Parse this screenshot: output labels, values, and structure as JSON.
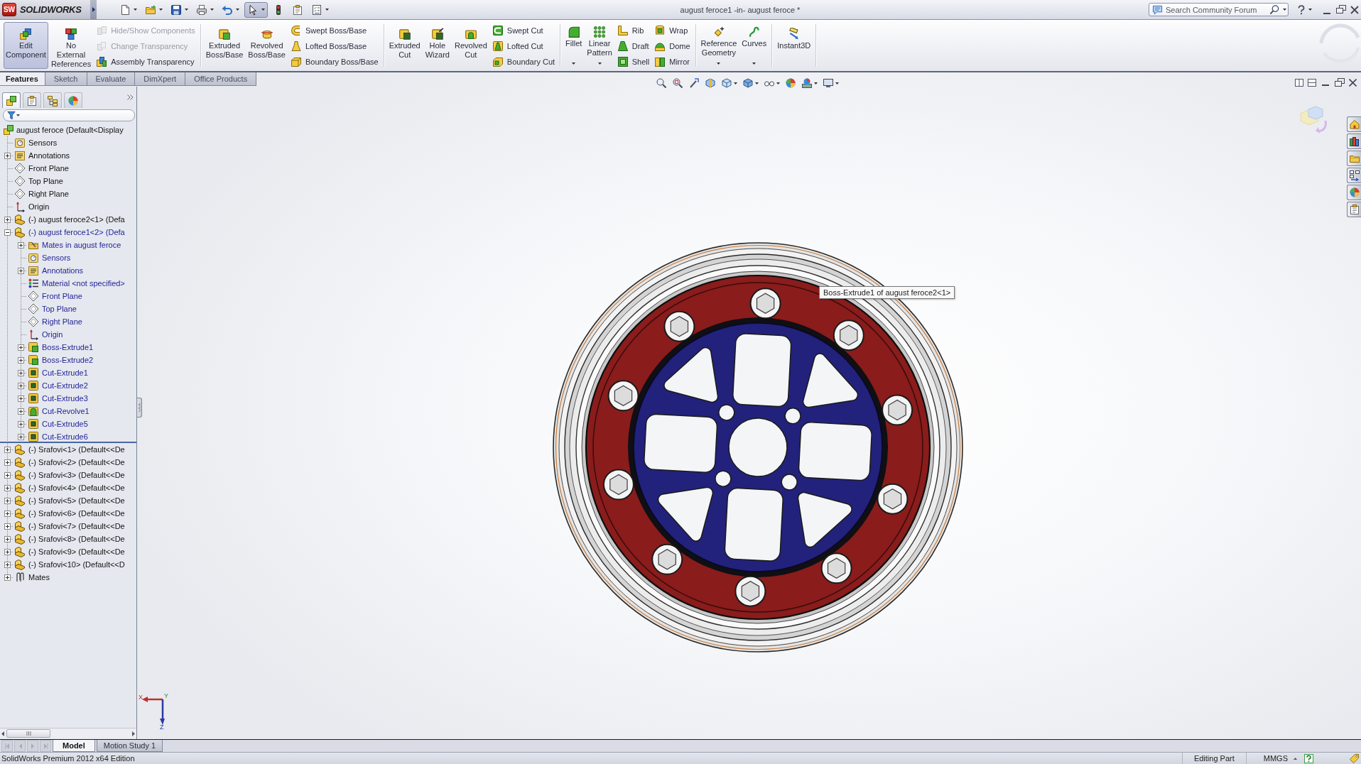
{
  "title_bar": {
    "logo": {
      "badge": "SW",
      "text": "SOLIDWORKS"
    },
    "quick_access": [
      {
        "kind": "new",
        "dropdown": true,
        "pressed": false
      },
      {
        "kind": "open",
        "dropdown": true,
        "pressed": false
      },
      {
        "kind": "save",
        "dropdown": true,
        "pressed": false
      },
      {
        "kind": "print",
        "dropdown": true,
        "pressed": false
      },
      {
        "kind": "undo",
        "dropdown": true,
        "pressed": false
      },
      {
        "kind": "select",
        "dropdown": true,
        "pressed": true
      },
      {
        "kind": "rebuild",
        "dropdown": false,
        "pressed": false
      },
      {
        "kind": "properties",
        "dropdown": false,
        "pressed": false
      },
      {
        "kind": "options",
        "dropdown": true,
        "pressed": false
      }
    ],
    "title": "august feroce1 -in- august feroce *",
    "search": {
      "placeholder": "Search Community Forum"
    }
  },
  "ribbon": {
    "groups": [
      {
        "large": [
          {
            "label": "Edit\nComponent",
            "kind": "edit",
            "active": true,
            "dropdown": false
          },
          {
            "label": "No\nExternal\nReferences",
            "kind": "references",
            "active": false,
            "dropdown": false
          }
        ],
        "columns": [
          [
            {
              "label": "Hide/Show Components",
              "kind": "hide",
              "disabled": true
            },
            {
              "label": "Change Transparency",
              "kind": "transparency",
              "disabled": true
            },
            {
              "label": "Assembly Transparency",
              "kind": "assembly",
              "disabled": false
            }
          ]
        ]
      },
      {
        "large": [
          {
            "label": "Extruded\nBoss/Base",
            "kind": "extrude",
            "active": false,
            "dropdown": false
          },
          {
            "label": "Revolved\nBoss/Base",
            "kind": "revolve",
            "active": false,
            "dropdown": false
          }
        ],
        "columns": [
          [
            {
              "label": "Swept Boss/Base",
              "kind": "sweep",
              "disabled": false
            },
            {
              "label": "Lofted Boss/Base",
              "kind": "loft",
              "disabled": false
            },
            {
              "label": "Boundary Boss/Base",
              "kind": "boundary",
              "disabled": false
            }
          ]
        ]
      },
      {
        "large": [
          {
            "label": "Extruded\nCut",
            "kind": "cut",
            "active": false,
            "dropdown": false
          },
          {
            "label": "Hole\nWizard",
            "kind": "hole",
            "active": false,
            "dropdown": false
          },
          {
            "label": "Revolved\nCut",
            "kind": "revolvecut",
            "active": false,
            "dropdown": false
          }
        ],
        "columns": [
          [
            {
              "label": "Swept Cut",
              "kind": "sweptcut",
              "disabled": false
            },
            {
              "label": "Lofted Cut",
              "kind": "loftcut",
              "disabled": false
            },
            {
              "label": "Boundary Cut",
              "kind": "boundarycut",
              "disabled": false
            }
          ]
        ]
      },
      {
        "large": [
          {
            "label": "Fillet",
            "kind": "fillet",
            "active": false,
            "dropdown": true
          },
          {
            "label": "Linear\nPattern",
            "kind": "pattern",
            "active": false,
            "dropdown": true
          }
        ],
        "columns": [
          [
            {
              "label": "Rib",
              "kind": "rib",
              "disabled": false
            },
            {
              "label": "Draft",
              "kind": "draft",
              "disabled": false
            },
            {
              "label": "Shell",
              "kind": "shell",
              "disabled": false
            }
          ],
          [
            {
              "label": "Wrap",
              "kind": "wrap",
              "disabled": false
            },
            {
              "label": "Dome",
              "kind": "dome",
              "disabled": false
            },
            {
              "label": "Mirror",
              "kind": "mirror",
              "disabled": false
            }
          ]
        ]
      },
      {
        "large": [
          {
            "label": "Reference\nGeometry",
            "kind": "reference",
            "active": false,
            "dropdown": true
          },
          {
            "label": "Curves",
            "kind": "curves",
            "active": false,
            "dropdown": true
          }
        ]
      },
      {
        "large": [
          {
            "label": "Instant3D",
            "kind": "instant3d",
            "active": false,
            "dropdown": false
          }
        ]
      }
    ]
  },
  "command_tabs": [
    {
      "label": "Features",
      "selected": true
    },
    {
      "label": "Sketch",
      "selected": false
    },
    {
      "label": "Evaluate",
      "selected": false
    },
    {
      "label": "DimXpert",
      "selected": false
    },
    {
      "label": "Office Products",
      "selected": false
    }
  ],
  "feature_manager": {
    "tabs": [
      {
        "kind": "tree",
        "selected": true
      },
      {
        "kind": "properties",
        "selected": false
      },
      {
        "kind": "configurations",
        "selected": false
      },
      {
        "kind": "display",
        "selected": false
      }
    ],
    "tree": {
      "label": "august feroce (Default<Display",
      "kind": "assembly",
      "children": [
        {
          "label": "Sensors",
          "kind": "sensors"
        },
        {
          "label": "Annotations",
          "kind": "annotations",
          "expanded": false
        },
        {
          "label": "Front Plane",
          "kind": "plane"
        },
        {
          "label": "Top Plane",
          "kind": "plane"
        },
        {
          "label": "Right Plane",
          "kind": "plane"
        },
        {
          "label": "Origin",
          "kind": "origin"
        },
        {
          "label": "(-) august feroce2<1> (Defa",
          "kind": "component",
          "expanded": false,
          "editing": false
        },
        {
          "label": "(-) august feroce1<2> (Defa",
          "kind": "component",
          "expanded": true,
          "editing": true,
          "children": [
            {
              "label": "Mates in august feroce",
              "kind": "folder",
              "expanded": false
            },
            {
              "label": "Sensors",
              "kind": "sensors"
            },
            {
              "label": "Annotations",
              "kind": "annotations",
              "expanded": false
            },
            {
              "label": "Material <not specified>",
              "kind": "material"
            },
            {
              "label": "Front Plane",
              "kind": "plane"
            },
            {
              "label": "Top Plane",
              "kind": "plane"
            },
            {
              "label": "Right Plane",
              "kind": "plane"
            },
            {
              "label": "Origin",
              "kind": "origin"
            },
            {
              "label": "Boss-Extrude1",
              "kind": "boss",
              "expanded": false
            },
            {
              "label": "Boss-Extrude2",
              "kind": "boss",
              "expanded": false
            },
            {
              "label": "Cut-Extrude1",
              "kind": "cut",
              "expanded": false
            },
            {
              "label": "Cut-Extrude2",
              "kind": "cut",
              "expanded": false
            },
            {
              "label": "Cut-Extrude3",
              "kind": "cut",
              "expanded": false
            },
            {
              "label": "Cut-Revolve1",
              "kind": "revolve",
              "expanded": false
            },
            {
              "label": "Cut-Extrude5",
              "kind": "cut",
              "expanded": false
            },
            {
              "label": "Cut-Extrude6",
              "kind": "cut",
              "expanded": false
            }
          ]
        },
        {
          "label": "(-) Srafovi<1> (Default<<De",
          "kind": "component",
          "expanded": false,
          "editing": false
        },
        {
          "label": "(-) Srafovi<2> (Default<<De",
          "kind": "component",
          "expanded": false,
          "editing": false
        },
        {
          "label": "(-) Srafovi<3> (Default<<De",
          "kind": "component",
          "expanded": false,
          "editing": false
        },
        {
          "label": "(-) Srafovi<4> (Default<<De",
          "kind": "component",
          "expanded": false,
          "editing": false
        },
        {
          "label": "(-) Srafovi<5> (Default<<De",
          "kind": "component",
          "expanded": false,
          "editing": false
        },
        {
          "label": "(-) Srafovi<6> (Default<<De",
          "kind": "component",
          "expanded": false,
          "editing": false
        },
        {
          "label": "(-) Srafovi<7> (Default<<De",
          "kind": "component",
          "expanded": false,
          "editing": false
        },
        {
          "label": "(-) Srafovi<8> (Default<<De",
          "kind": "component",
          "expanded": false,
          "editing": false
        },
        {
          "label": "(-) Srafovi<9> (Default<<De",
          "kind": "component",
          "expanded": false,
          "editing": false
        },
        {
          "label": "(-) Srafovi<10> (Default<<D",
          "kind": "component",
          "expanded": false,
          "editing": false
        },
        {
          "label": "Mates",
          "kind": "mates",
          "expanded": false
        }
      ]
    }
  },
  "graphics": {
    "tooltip": "Boss-Extrude1 of august feroce2<1>",
    "triad": {
      "x": "X",
      "y": "Y",
      "z": "Z"
    }
  },
  "bottom_tabs": [
    {
      "label": "Model",
      "selected": true
    },
    {
      "label": "Motion Study 1",
      "selected": false
    }
  ],
  "status_bar": {
    "edition": "SolidWorks Premium 2012 x64 Edition",
    "mode": "Editing Part",
    "units": "MMGS"
  }
}
